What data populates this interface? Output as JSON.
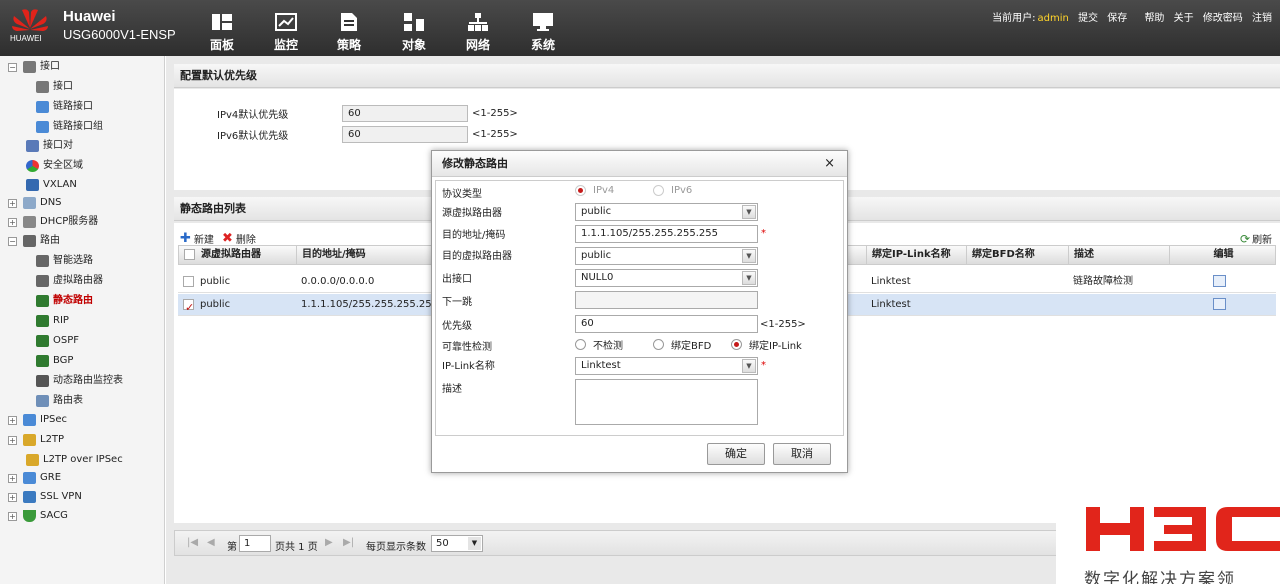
{
  "header": {
    "brand": "Huawei",
    "model": "USG6000V1-ENSP",
    "logo_text": "HUAWEI",
    "nav": [
      {
        "label": "面板",
        "icon": "dashboard-icon"
      },
      {
        "label": "监控",
        "icon": "monitor-icon"
      },
      {
        "label": "策略",
        "icon": "policy-icon"
      },
      {
        "label": "对象",
        "icon": "object-icon"
      },
      {
        "label": "网络",
        "icon": "network-icon"
      },
      {
        "label": "系统",
        "icon": "system-icon"
      }
    ],
    "current_user_label": "当前用户:",
    "current_user": "admin",
    "links": [
      "提交",
      "保存",
      "帮助",
      "关于",
      "修改密码",
      "注销"
    ]
  },
  "sidebar": {
    "items": [
      {
        "label": "接口"
      },
      {
        "label": "接口"
      },
      {
        "label": "链路接口"
      },
      {
        "label": "链路接口组"
      },
      {
        "label": "接口对"
      },
      {
        "label": "安全区域"
      },
      {
        "label": "VXLAN"
      },
      {
        "label": "DNS"
      },
      {
        "label": "DHCP服务器"
      },
      {
        "label": "路由"
      },
      {
        "label": "智能选路"
      },
      {
        "label": "虚拟路由器"
      },
      {
        "label": "静态路由"
      },
      {
        "label": "RIP"
      },
      {
        "label": "OSPF"
      },
      {
        "label": "BGP"
      },
      {
        "label": "动态路由监控表"
      },
      {
        "label": "路由表"
      },
      {
        "label": "IPSec"
      },
      {
        "label": "L2TP"
      },
      {
        "label": "L2TP over IPSec"
      },
      {
        "label": "GRE"
      },
      {
        "label": "SSL VPN"
      },
      {
        "label": "SACG"
      }
    ]
  },
  "priority_panel": {
    "title": "配置默认优先级",
    "ipv4_label": "IPv4默认优先级",
    "ipv4_value": "60",
    "ipv6_label": "IPv6默认优先级",
    "ipv6_value": "60",
    "range": "<1-255>"
  },
  "route_list": {
    "title": "静态路由列表",
    "new_label": "新建",
    "delete_label": "删除",
    "refresh_label": "刷新",
    "columns": [
      "源虚拟路由器",
      "目的地址/掩码",
      "绑定IP-Link名称",
      "绑定BFD名称",
      "描述",
      "编辑"
    ],
    "rows": [
      {
        "src": "public",
        "dest": "0.0.0.0/0.0.0.0",
        "iplink": "Linktest",
        "bfd": "",
        "desc": "链路故障检测",
        "checked": false
      },
      {
        "src": "public",
        "dest": "1.1.1.105/255.255.255.255",
        "iplink": "Linktest",
        "bfd": "",
        "desc": "",
        "checked": true
      }
    ]
  },
  "pager": {
    "page_prefix": "第",
    "page": "1",
    "page_suffix": "页共 1 页",
    "per_page_label": "每页显示条数",
    "per_page": "50"
  },
  "modal": {
    "title": "修改静态路由",
    "close": "×",
    "protocol_label": "协议类型",
    "ipv4": "IPv4",
    "ipv6": "IPv6",
    "src_vr_label": "源虚拟路由器",
    "src_vr": "public",
    "dest_label": "目的地址/掩码",
    "dest": "1.1.1.105/255.255.255.255",
    "dst_vr_label": "目的虚拟路由器",
    "dst_vr": "public",
    "out_if_label": "出接口",
    "out_if": "NULL0",
    "next_hop_label": "下一跳",
    "next_hop": "",
    "priority_label": "优先级",
    "priority": "60",
    "priority_range": "<1-255>",
    "reliability_label": "可靠性检测",
    "opt_none": "不检测",
    "opt_bfd": "绑定BFD",
    "opt_iplink": "绑定IP-Link",
    "iplink_label": "IP-Link名称",
    "iplink": "Linktest",
    "desc_label": "描述",
    "desc": "",
    "ok": "确定",
    "cancel": "取消",
    "required_mark": "*"
  },
  "watermark": {
    "logo": "H3C",
    "tagline": "数字化解决方案领"
  }
}
